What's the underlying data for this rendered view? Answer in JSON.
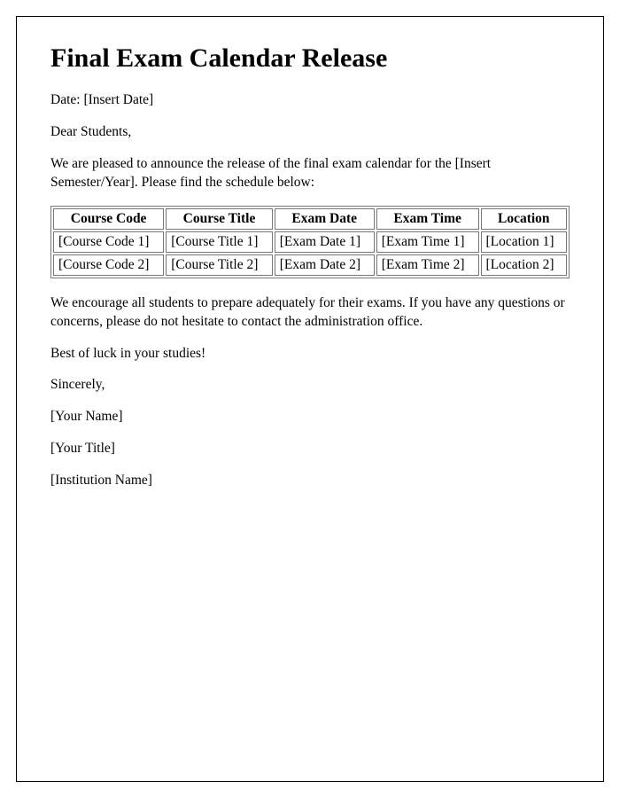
{
  "title": "Final Exam Calendar Release",
  "date_line": "Date: [Insert Date]",
  "salutation": "Dear Students,",
  "intro": "We are pleased to announce the release of the final exam calendar for the [Insert Semester/Year]. Please find the schedule below:",
  "table": {
    "headers": [
      "Course Code",
      "Course Title",
      "Exam Date",
      "Exam Time",
      "Location"
    ],
    "rows": [
      [
        "[Course Code 1]",
        "[Course Title 1]",
        "[Exam Date 1]",
        "[Exam Time 1]",
        "[Location 1]"
      ],
      [
        "[Course Code 2]",
        "[Course Title 2]",
        "[Exam Date 2]",
        "[Exam Time 2]",
        "[Location 2]"
      ]
    ]
  },
  "encourage": "We encourage all students to prepare adequately for their exams. If you have any questions or concerns, please do not hesitate to contact the administration office.",
  "goodluck": "Best of luck in your studies!",
  "closing": "Sincerely,",
  "name": "[Your Name]",
  "title_line": "[Your Title]",
  "institution": "[Institution Name]"
}
